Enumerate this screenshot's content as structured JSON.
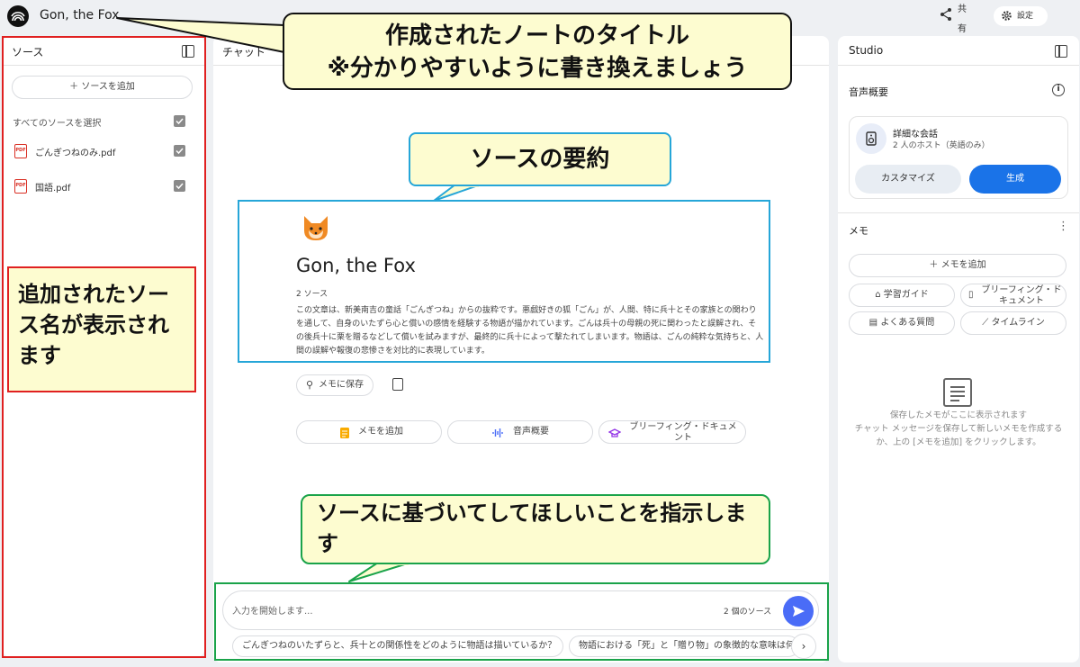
{
  "topbar": {
    "notebook_title": "Gon, the Fox",
    "share_label": "共有",
    "settings_label": "設定"
  },
  "sources_panel": {
    "title": "ソース",
    "add_button": "ソースを追加",
    "select_all": "すべてのソースを選択",
    "items": [
      {
        "name": "ごんぎつねのみ.pdf",
        "icon": "pdf-icon",
        "checked": true
      },
      {
        "name": "国語.pdf",
        "icon": "pdf-icon",
        "checked": true
      }
    ]
  },
  "chat_panel": {
    "title": "チャット",
    "notebook_icon": "fox-emoji",
    "notebook_title": "Gon, the Fox",
    "source_count": "2 ソース",
    "summary": "この文章は、新美南吉の童話「ごんぎつね」からの抜粋です。悪戯好きの狐「ごん」が、人間、特に兵十とその家族との関わりを通して、自身のいたずら心と償いの感情を経験する物語が描かれています。ごんは兵十の母親の死に関わったと誤解され、その後兵十に栗を贈るなどして償いを試みますが、最終的に兵十によって撃たれてしまいます。物語は、ごんの純粋な気持ちと、人間の誤解や報復の悲惨さを対比的に表現しています。",
    "save_memo": "メモに保存",
    "actions": [
      {
        "label": "メモを追加",
        "icon": "note-icon"
      },
      {
        "label": "音声概要",
        "icon": "audio-wave-icon"
      },
      {
        "label": "ブリーフィング・ドキュメント",
        "icon": "graduation-cap-icon"
      }
    ],
    "input_placeholder": "入力を開始します...",
    "input_source_count": "2 個のソース",
    "suggestions": [
      "ごんぎつねのいたずらと、兵十との関係性をどのように物語は描いているか？",
      "物語における「死」と「贈り物」の象徴的な意味は何"
    ]
  },
  "studio_panel": {
    "title": "Studio",
    "audio_overview_heading": "音声概要",
    "audio_card": {
      "title": "詳細な会話",
      "subtitle": "2 人のホスト（英語のみ）",
      "customize": "カスタマイズ",
      "generate": "生成"
    },
    "memo_heading": "メモ",
    "add_memo": "メモを追加",
    "memo_chips": [
      {
        "label": "学習ガイド",
        "icon": "graduation-cap-icon"
      },
      {
        "label": "ブリーフィング・ドキュメント",
        "icon": "document-icon"
      },
      {
        "label": "よくある質問",
        "icon": "faq-icon"
      },
      {
        "label": "タイムライン",
        "icon": "timeline-icon"
      }
    ],
    "empty_line1": "保存したメモがここに表示されます",
    "empty_line2": "チャット メッセージを保存して新しいメモを作成するか、上の [メモを追加] をクリックします。"
  },
  "annotations": {
    "title_callout_line1": "作成されたノートのタイトル",
    "title_callout_line2": "※分かりやすいように書き換えましょう",
    "summary_callout": "ソースの要約",
    "source_callout": "追加されたソース名が表示されます",
    "prompt_callout": "ソースに基づいてしてほしいことを指示します"
  },
  "colors": {
    "accent": "#1a73e8",
    "send": "#4a6cf7",
    "callout_fill": "#fdfcd0",
    "frame_red": "#e02020",
    "frame_green": "#1aa34a",
    "frame_blue": "#26a6d8"
  }
}
